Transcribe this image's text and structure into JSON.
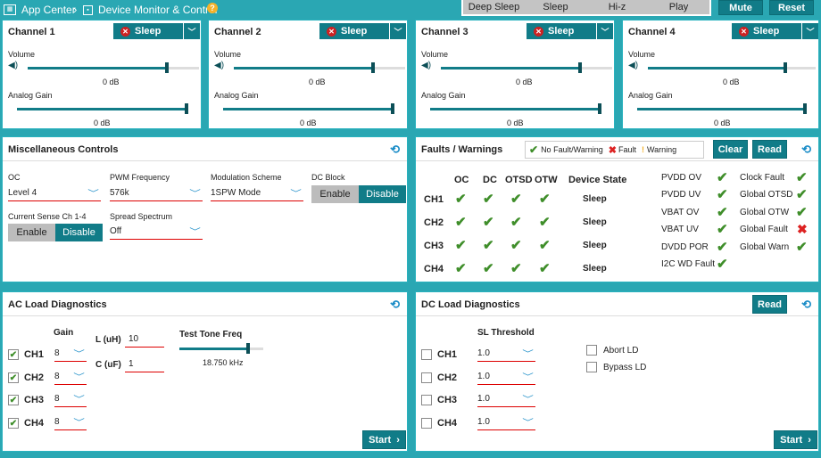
{
  "topbar": {
    "app_center": "App Center",
    "separator": "›",
    "device_monitor": "Device Monitor & Control",
    "help_badge": "?"
  },
  "state_bar": [
    "Deep Sleep",
    "Sleep",
    "Hi-z",
    "Play"
  ],
  "mute_label": "Mute",
  "reset_label": "Reset",
  "channels": [
    {
      "title": "Channel 1",
      "state": "Sleep",
      "volume_label": "Volume",
      "volume_value": "0 dB",
      "gain_label": "Analog Gain",
      "gain_value": "0 dB"
    },
    {
      "title": "Channel 2",
      "state": "Sleep",
      "volume_label": "Volume",
      "volume_value": "0 dB",
      "gain_label": "Analog Gain",
      "gain_value": "0 dB"
    },
    {
      "title": "Channel 3",
      "state": "Sleep",
      "volume_label": "Volume",
      "volume_value": "0 dB",
      "gain_label": "Analog Gain",
      "gain_value": "0 dB"
    },
    {
      "title": "Channel 4",
      "state": "Sleep",
      "volume_label": "Volume",
      "volume_value": "0 dB",
      "gain_label": "Analog Gain",
      "gain_value": "0 dB"
    }
  ],
  "misc": {
    "title": "Miscellaneous Controls",
    "oc_label": "OC",
    "oc_value": "Level 4",
    "pwm_label": "PWM Frequency",
    "pwm_value": "576k",
    "mod_label": "Modulation Scheme",
    "mod_value": "1SPW Mode",
    "dcblock_label": "DC Block",
    "enable": "Enable",
    "disable": "Disable",
    "current_label": "Current Sense Ch 1-4",
    "spread_label": "Spread Spectrum",
    "spread_value": "Off"
  },
  "faults": {
    "title": "Faults / Warnings",
    "legend_ok": "No Fault/Warning",
    "legend_fault": "Fault",
    "legend_warn": "Warning",
    "clear": "Clear",
    "read": "Read",
    "cols": [
      "OC",
      "DC",
      "OTSD",
      "OTW",
      "Device State"
    ],
    "rows": [
      {
        "ch": "CH1",
        "state": "Sleep"
      },
      {
        "ch": "CH2",
        "state": "Sleep"
      },
      {
        "ch": "CH3",
        "state": "Sleep"
      },
      {
        "ch": "CH4",
        "state": "Sleep"
      }
    ],
    "col2": [
      "PVDD OV",
      "PVDD UV",
      "VBAT OV",
      "VBAT UV",
      "DVDD POR",
      "I2C WD Fault"
    ],
    "col3": [
      "Clock Fault",
      "Global OTSD",
      "Global OTW",
      "Global Fault",
      "Global Warn"
    ]
  },
  "ac": {
    "title": "AC Load Diagnostics",
    "gain_label": "Gain",
    "channels": [
      {
        "ch": "CH1",
        "gain": "8",
        "checked": true
      },
      {
        "ch": "CH2",
        "gain": "8",
        "checked": true
      },
      {
        "ch": "CH3",
        "gain": "8",
        "checked": true
      },
      {
        "ch": "CH4",
        "gain": "8",
        "checked": true
      }
    ],
    "l_label": "L (uH)",
    "l_value": "10",
    "c_label": "C (uF)",
    "c_value": "1",
    "tone_label": "Test Tone Freq",
    "tone_value": "18.750 kHz",
    "start": "Start"
  },
  "dc": {
    "title": "DC Load Diagnostics",
    "read": "Read",
    "sl_label": "SL Threshold",
    "channels": [
      {
        "ch": "CH1",
        "value": "1.0"
      },
      {
        "ch": "CH2",
        "value": "1.0"
      },
      {
        "ch": "CH3",
        "value": "1.0"
      },
      {
        "ch": "CH4",
        "value": "1.0"
      }
    ],
    "abort": "Abort LD",
    "bypass": "Bypass LD",
    "start": "Start"
  },
  "colors": {
    "accent": "#117c88",
    "frame": "#2aa7b3",
    "fault": "#dd2222",
    "ok": "#3f8e2a"
  }
}
